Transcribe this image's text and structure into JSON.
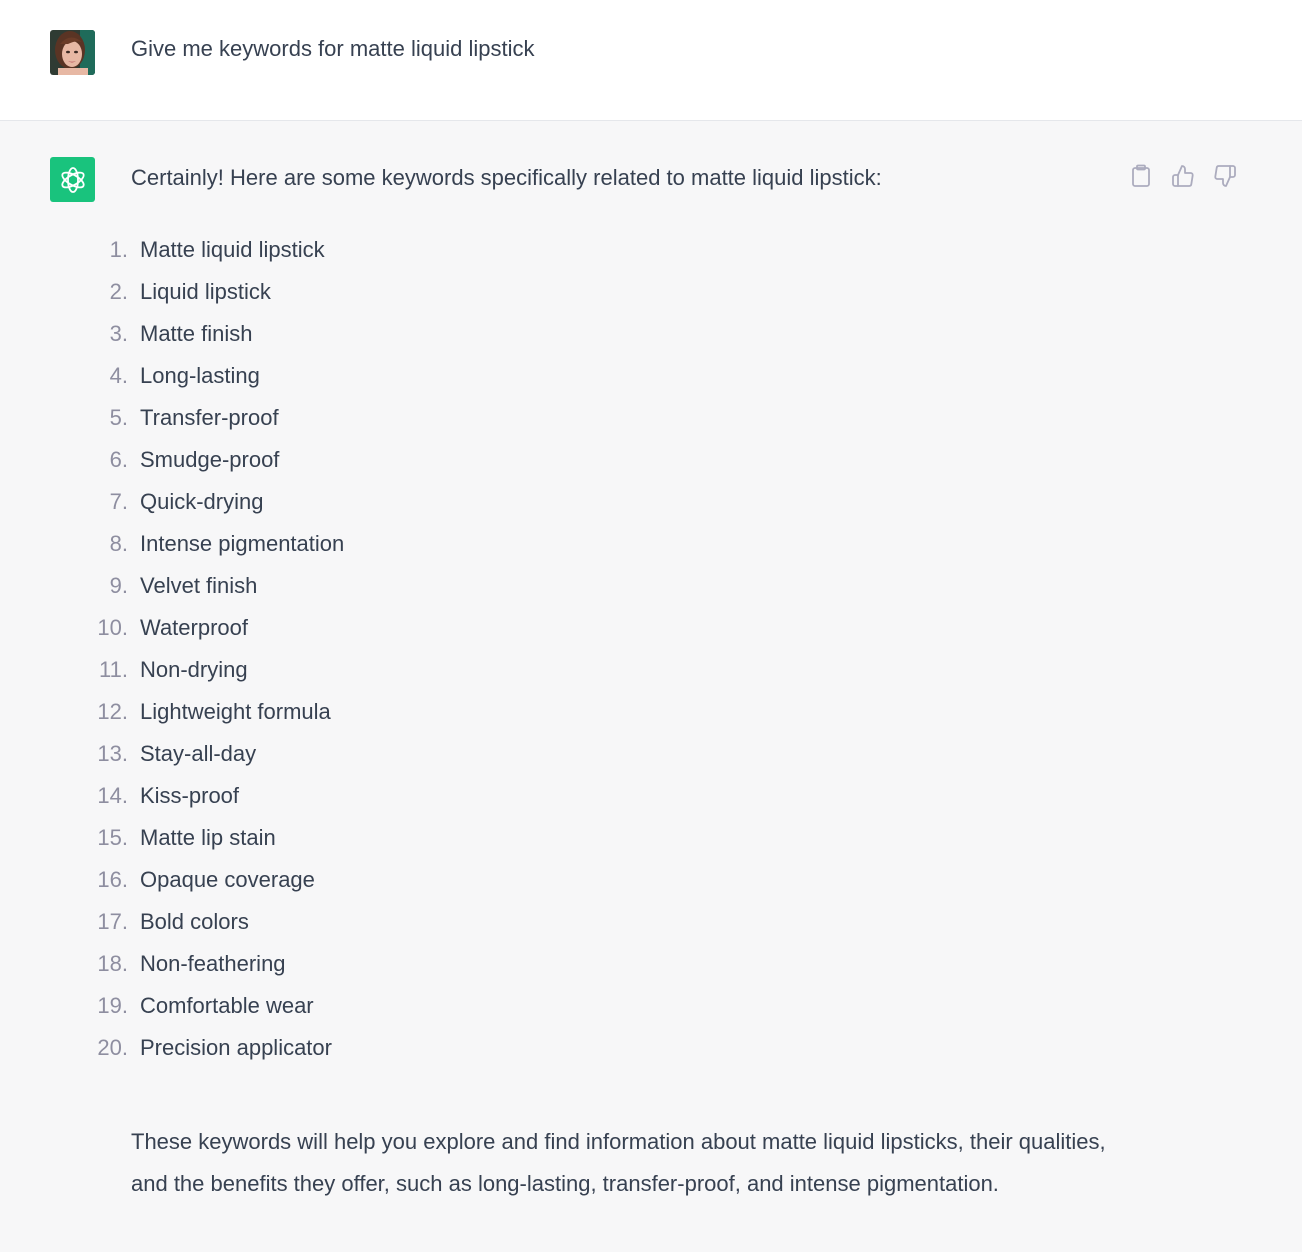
{
  "user_message": {
    "avatar": "user-avatar-photo",
    "text": "Give me keywords for matte liquid lipstick"
  },
  "assistant_message": {
    "avatar": "openai-logo-icon",
    "accent_color": "#19c37d",
    "intro": "Certainly! Here are some keywords specifically related to matte liquid lipstick:",
    "keywords": [
      {
        "num": "1.",
        "text": "Matte liquid lipstick"
      },
      {
        "num": "2.",
        "text": "Liquid lipstick"
      },
      {
        "num": "3.",
        "text": "Matte finish"
      },
      {
        "num": "4.",
        "text": "Long-lasting"
      },
      {
        "num": "5.",
        "text": "Transfer-proof"
      },
      {
        "num": "6.",
        "text": "Smudge-proof"
      },
      {
        "num": "7.",
        "text": "Quick-drying"
      },
      {
        "num": "8.",
        "text": "Intense pigmentation"
      },
      {
        "num": "9.",
        "text": "Velvet finish"
      },
      {
        "num": "10.",
        "text": "Waterproof"
      },
      {
        "num": "11.",
        "text": "Non-drying"
      },
      {
        "num": "12.",
        "text": "Lightweight formula"
      },
      {
        "num": "13.",
        "text": "Stay-all-day"
      },
      {
        "num": "14.",
        "text": "Kiss-proof"
      },
      {
        "num": "15.",
        "text": "Matte lip stain"
      },
      {
        "num": "16.",
        "text": "Opaque coverage"
      },
      {
        "num": "17.",
        "text": "Bold colors"
      },
      {
        "num": "18.",
        "text": "Non-feathering"
      },
      {
        "num": "19.",
        "text": "Comfortable wear"
      },
      {
        "num": "20.",
        "text": "Precision applicator"
      }
    ],
    "outro": "These keywords will help you explore and find information about matte liquid lipsticks, their qualities, and the benefits they offer, such as long-lasting, transfer-proof, and intense pigmentation.",
    "actions": [
      "clipboard-icon",
      "thumbs-up-icon",
      "thumbs-down-icon"
    ]
  }
}
